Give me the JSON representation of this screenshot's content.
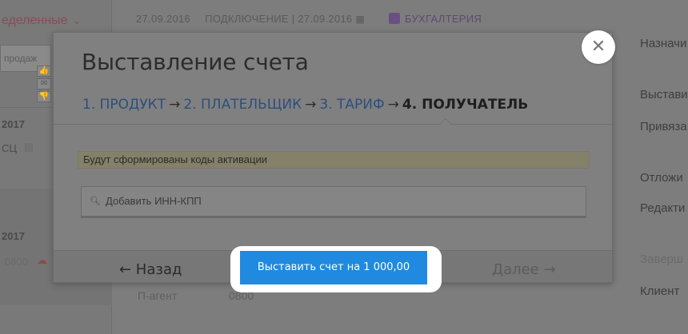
{
  "background": {
    "left_panel": {
      "filter_label": "еделенные",
      "search_placeholder": "продаж",
      "mini_icons": [
        "thumbs-up-icon",
        "mail-icon",
        "thumbs-down-icon"
      ],
      "rows": [
        {
          "year": "2017",
          "sub": "СЦ"
        },
        {
          "year": "2017",
          "sub": "0800"
        }
      ]
    },
    "top_bar": {
      "date": "27.09.2016",
      "connection_label": "ПОДКЛЮЧЕНИЕ | 27.09.2016",
      "accounting_label": "БУХГАЛТЕРИЯ"
    },
    "right_panel": {
      "items": [
        "Назначи",
        "Выстави",
        "Привяза",
        "Отложи",
        "Редакти",
        "Заверш",
        "Клиент"
      ]
    },
    "bottom": {
      "agent_label": "П-агент",
      "agent_value": "0800"
    }
  },
  "modal": {
    "title": "Выставление счета",
    "steps": [
      {
        "label": "1. ПРОДУКТ",
        "state": "link"
      },
      {
        "label": "2. ПЛАТЕЛЬЩИК",
        "state": "link"
      },
      {
        "label": "3. ТАРИФ",
        "state": "link"
      },
      {
        "label": "4. ПОЛУЧАТЕЛЬ",
        "state": "current"
      }
    ],
    "arrow": "→",
    "notice": "Будут сформированы коды активации",
    "inn_placeholder": "Добавить ИНН-КПП",
    "back_label": "← Назад",
    "next_label": "Далее →",
    "submit_label": "Выставить счет на 1 000,00",
    "close_symbol": "✕"
  },
  "colors": {
    "primary_button": "#1f8ae0",
    "step_link": "#2c4f7c",
    "highlight": "#ffffff"
  }
}
